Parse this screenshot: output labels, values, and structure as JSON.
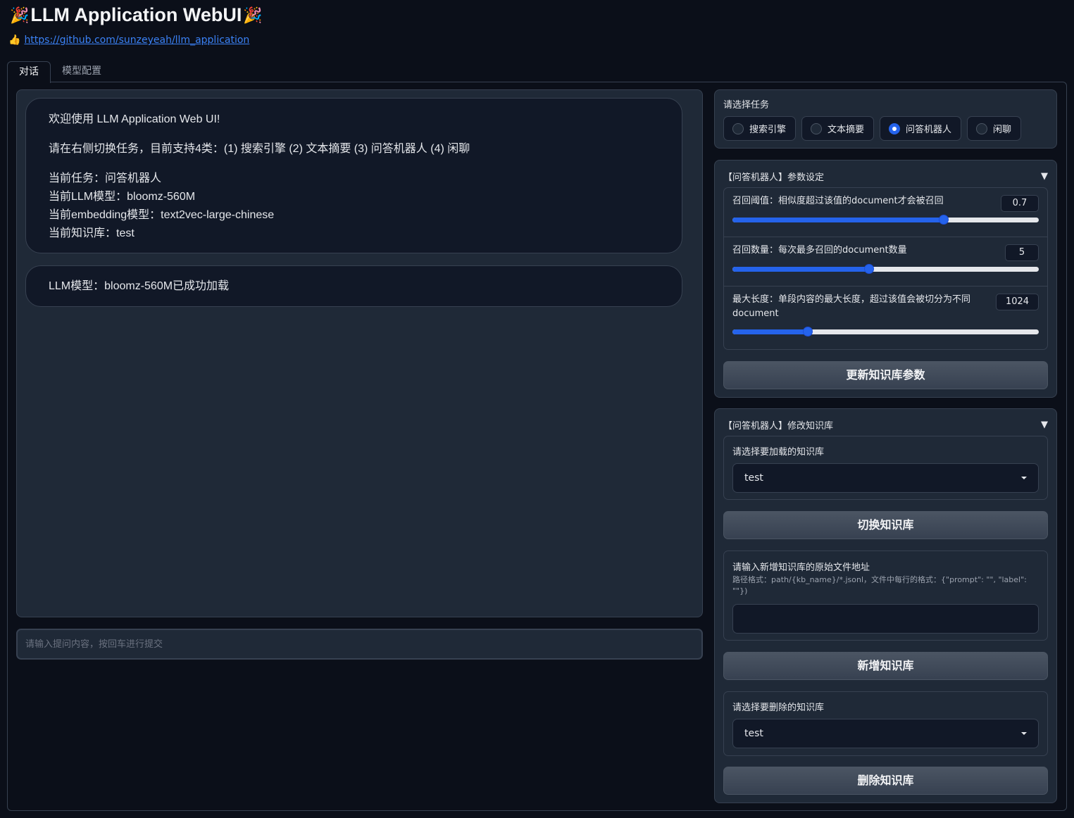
{
  "header": {
    "title": "LLM Application WebUI",
    "title_icon": "party-popper-icon",
    "link_icon": "thumbs-up-icon",
    "link_text": "https://github.com/sunzeyeah/llm_application"
  },
  "tabs": [
    {
      "label": "对话",
      "active": true
    },
    {
      "label": "模型配置",
      "active": false
    }
  ],
  "chat": {
    "messages": [
      {
        "welcome": "欢迎使用 LLM Application Web UI!",
        "intro": "请在右侧切换任务，目前支持4类：(1) 搜索引擎 (2) 文本摘要 (3) 问答机器人 (4) 闲聊",
        "current_task": "当前任务：问答机器人",
        "current_llm": "当前LLM模型：bloomz-560M",
        "current_embedding": "当前embedding模型：text2vec-large-chinese",
        "current_kb": "当前知识库：test"
      },
      {
        "text": "LLM模型：bloomz-560M已成功加载"
      }
    ],
    "input_placeholder": "请输入提问内容，按回车进行提交"
  },
  "task_selector": {
    "label": "请选择任务",
    "options": [
      "搜索引擎",
      "文本摘要",
      "问答机器人",
      "闲聊"
    ],
    "selected": "问答机器人"
  },
  "params": {
    "title": "【问答机器人】参数设定",
    "sliders": [
      {
        "label": "召回阈值：相似度超过该值的document才会被召回",
        "value": "0.7",
        "fraction": 0.69
      },
      {
        "label": "召回数量：每次最多召回的document数量",
        "value": "5",
        "fraction": 0.445
      },
      {
        "label": "最大长度：单段内容的最大长度，超过该值会被切分为不同document",
        "value": "1024",
        "fraction": 0.245
      }
    ],
    "update_button": "更新知识库参数"
  },
  "kb": {
    "title": "【问答机器人】修改知识库",
    "load_label": "请选择要加载的知识库",
    "load_value": "test",
    "switch_button": "切换知识库",
    "new_label": "请输入新增知识库的原始文件地址",
    "new_hint": "路径格式：path/{kb_name}/*.jsonl，文件中每行的格式：{\"prompt\": \"\", \"label\": \"\"})",
    "new_value": "",
    "add_button": "新增知识库",
    "delete_label": "请选择要删除的知识库",
    "delete_value": "test",
    "delete_button": "删除知识库"
  },
  "colors": {
    "background": "#0b0f19",
    "panel": "#1f2937",
    "accent": "#2563eb",
    "link": "#3b82f6"
  }
}
